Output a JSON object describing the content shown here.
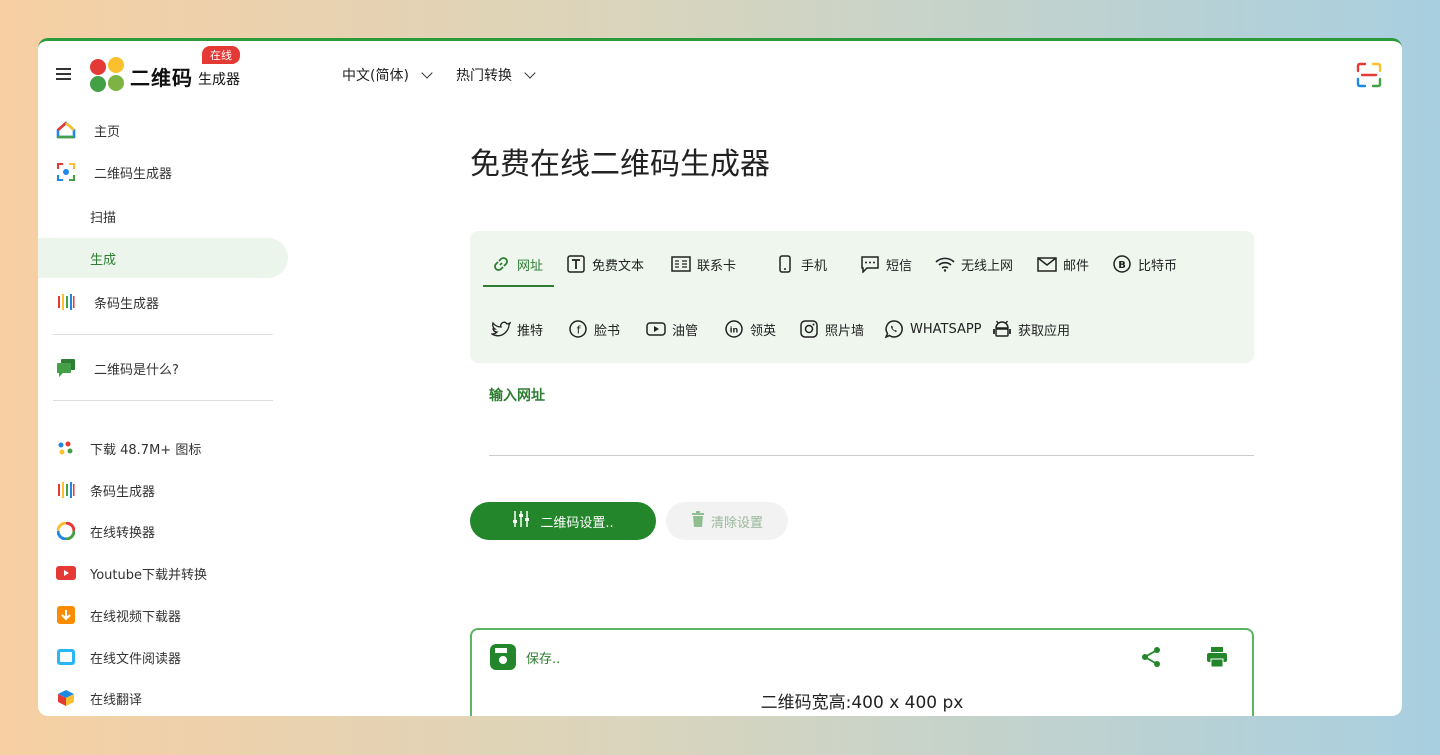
{
  "header": {
    "brand": "二维码",
    "brand_sub": "生成器",
    "badge": "在线",
    "nav": [
      {
        "label": "中文(简体)"
      },
      {
        "label": "热门转换"
      }
    ]
  },
  "sidebar": {
    "items": [
      {
        "label": "主页",
        "icon": "home-icon"
      },
      {
        "label": "二维码生成器",
        "icon": "qr-scan-icon"
      },
      {
        "label": "扫描"
      },
      {
        "label": "生成"
      },
      {
        "label": "条码生成器",
        "icon": "barcode-icon"
      },
      {
        "label": "二维码是什么?",
        "icon": "chat-icon"
      },
      {
        "label": "下载 48.7M+ 图标",
        "icon": "dots-icon"
      },
      {
        "label": "条码生成器",
        "icon": "barcode-icon"
      },
      {
        "label": "在线转换器",
        "icon": "converter-icon"
      },
      {
        "label": "Youtube下载并转换",
        "icon": "youtube-icon"
      },
      {
        "label": "在线视频下载器",
        "icon": "video-download-icon"
      },
      {
        "label": "在线文件阅读器",
        "icon": "file-reader-icon"
      },
      {
        "label": "在线翻译",
        "icon": "translate-icon"
      }
    ]
  },
  "main": {
    "title": "免费在线二维码生成器",
    "tabs_row1": [
      {
        "label": "网址",
        "icon": "link-icon"
      },
      {
        "label": "免费文本",
        "icon": "text-icon"
      },
      {
        "label": "联系卡",
        "icon": "vcard-icon"
      },
      {
        "label": "手机",
        "icon": "phone-icon"
      },
      {
        "label": "短信",
        "icon": "sms-icon"
      },
      {
        "label": "无线上网",
        "icon": "wifi-icon"
      },
      {
        "label": "邮件",
        "icon": "mail-icon"
      },
      {
        "label": "比特币",
        "icon": "bitcoin-icon"
      }
    ],
    "tabs_row2": [
      {
        "label": "推特",
        "icon": "twitter-icon"
      },
      {
        "label": "脸书",
        "icon": "facebook-icon"
      },
      {
        "label": "油管",
        "icon": "youtube-icon"
      },
      {
        "label": "领英",
        "icon": "linkedin-icon"
      },
      {
        "label": "照片墙",
        "icon": "instagram-icon"
      },
      {
        "label": "WHATSAPP",
        "icon": "whatsapp-icon"
      },
      {
        "label": "获取应用",
        "icon": "android-icon"
      }
    ],
    "input_label": "输入网址",
    "settings_button": "二维码设置..",
    "clear_button": "清除设置",
    "save_label": "保存..",
    "dimensions": "二维码宽高:400 x 400 px"
  },
  "colors": {
    "accent": "#23862b",
    "active_bg": "#ebf5ec",
    "badge": "#e53935"
  }
}
